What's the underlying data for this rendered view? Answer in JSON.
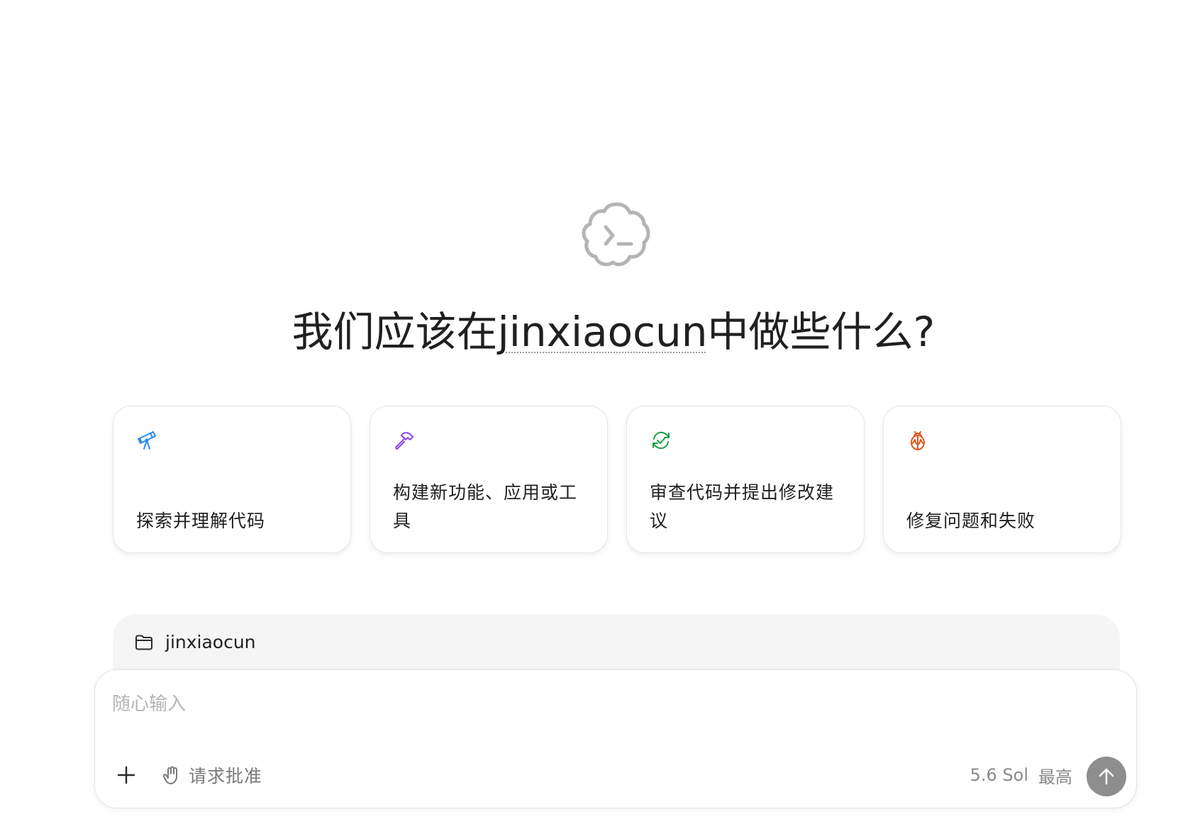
{
  "hero": {
    "logo_icon": "terminal-cloud-icon",
    "title_prefix": "我们应该在",
    "project_name": "jinxiaocun",
    "title_suffix": "中做些什么?"
  },
  "suggestions": [
    {
      "icon": "telescope-icon",
      "icon_color": "#2b8cee",
      "label": "探索并理解代码"
    },
    {
      "icon": "hammer-icon",
      "icon_color": "#8e44ec",
      "label": "构建新功能、应用或工具"
    },
    {
      "icon": "refresh-check-icon",
      "icon_color": "#1e9e4a",
      "label": "审查代码并提出修改建议"
    },
    {
      "icon": "bug-icon",
      "icon_color": "#e0541b",
      "label": "修复问题和失败"
    }
  ],
  "workspace": {
    "folder_icon": "folder-icon",
    "folder_name": "jinxiaocun"
  },
  "composer": {
    "placeholder": "随心输入",
    "value": "",
    "add_icon": "plus-icon",
    "approval_icon": "hand-icon",
    "approval_label": "请求批准",
    "model_label": "5.6 Sol",
    "effort_label": "最高",
    "send_icon": "arrow-up-icon"
  },
  "colors": {
    "send_button": "#8e8e8e",
    "folder_bar_bg": "#f5f5f5",
    "placeholder": "#b5b5b5"
  }
}
